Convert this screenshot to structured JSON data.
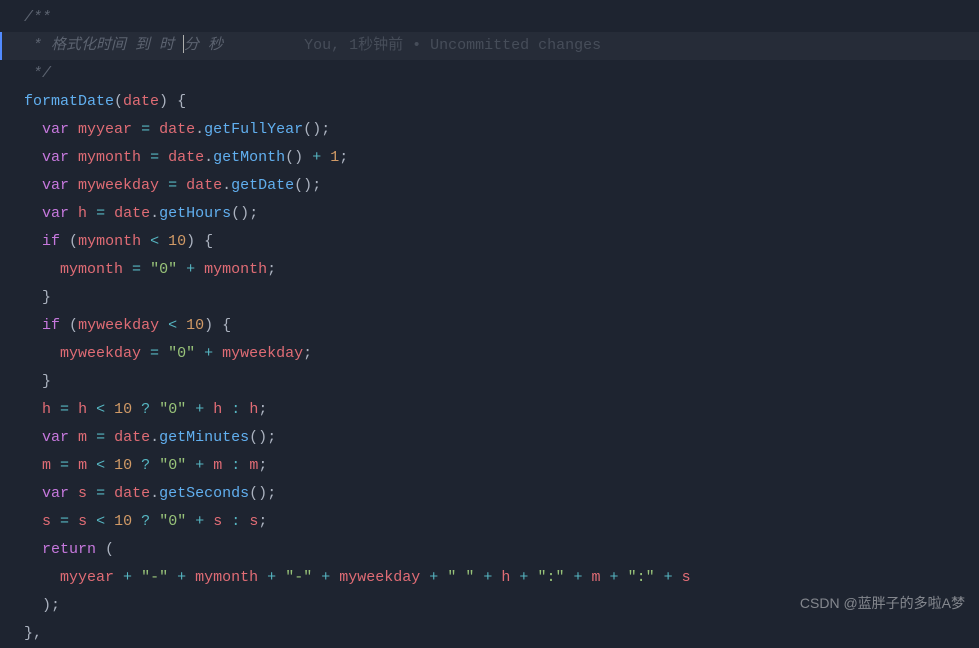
{
  "comment": {
    "open": "/**",
    "body_prefix": " * ",
    "body_text": "格式化时间 到 时 ",
    "body_after_cursor": "分 秒",
    "close": " */"
  },
  "gitlens": {
    "author": "You, ",
    "time": "1秒钟前",
    "separator": " • ",
    "message": "Uncommitted changes"
  },
  "code": {
    "func": "formatDate",
    "param": "date",
    "kw_var": "var",
    "kw_if": "if",
    "kw_return": "return",
    "v_myyear": "myyear",
    "v_mymonth": "mymonth",
    "v_myweekday": "myweekday",
    "v_h": "h",
    "v_m": "m",
    "v_s": "s",
    "obj_date": "date",
    "m_getFullYear": "getFullYear",
    "m_getMonth": "getMonth",
    "m_getDate": "getDate",
    "m_getHours": "getHours",
    "m_getMinutes": "getMinutes",
    "m_getSeconds": "getSeconds",
    "num_1": "1",
    "num_10": "10",
    "str_zero": "\"0\"",
    "str_dash": "\"-\"",
    "str_space": "\" \"",
    "str_colon": "\":\"",
    "op_eq": "=",
    "op_plus": "+",
    "op_lt": "<",
    "op_q": "?",
    "op_colon": ":",
    "p_open": "(",
    "p_close": ")",
    "b_open": "{",
    "b_close": "}",
    "semi": ";",
    "comma": ",",
    "dot": "."
  },
  "watermark": "CSDN @蓝胖子的多啦A梦"
}
